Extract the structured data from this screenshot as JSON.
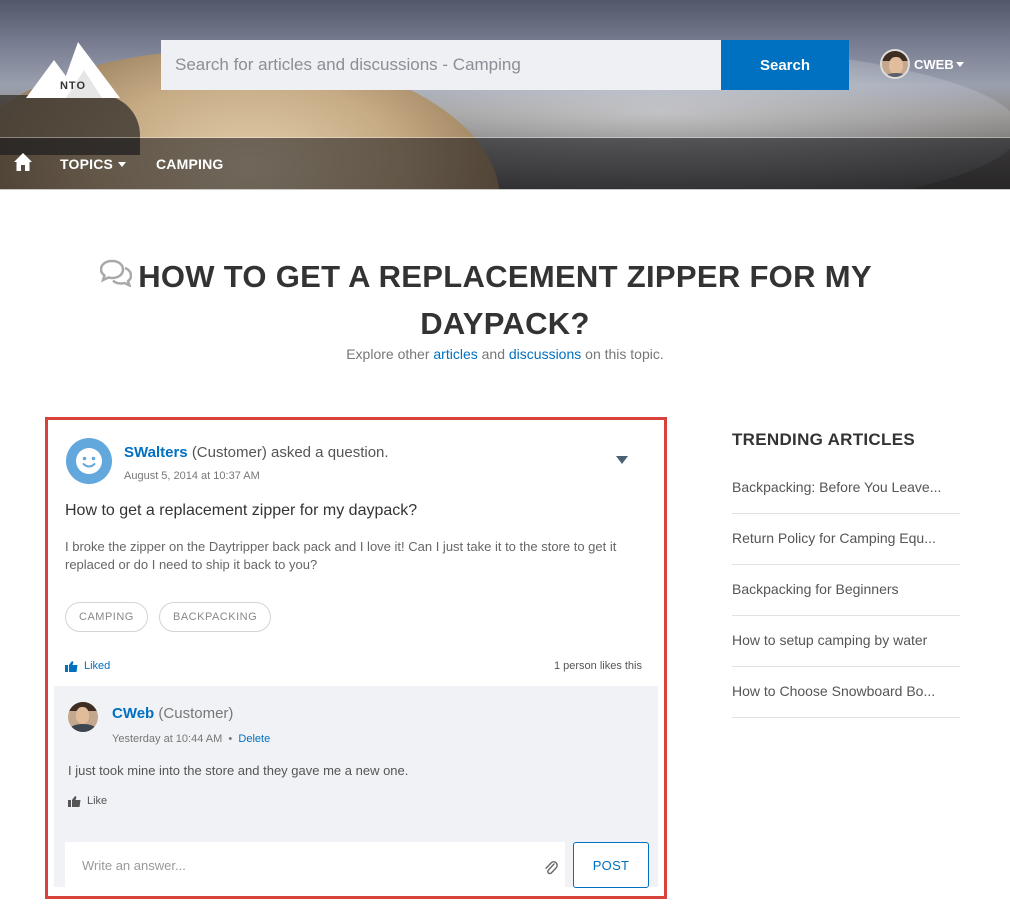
{
  "header": {
    "logo_text": "NTO",
    "search_placeholder": "Search for articles and discussions - Camping",
    "search_button": "Search",
    "user_name": "CWEB"
  },
  "nav": {
    "topics": "TOPICS",
    "camping": "CAMPING"
  },
  "page": {
    "title": "HOW TO GET A REPLACEMENT ZIPPER FOR MY DAYPACK?",
    "subtitle_prefix": "Explore other",
    "subtitle_link1": "articles",
    "subtitle_and": "and",
    "subtitle_link2": "discussions",
    "subtitle_suffix": "on this topic."
  },
  "question": {
    "author": "SWalters",
    "author_role": "(Customer) asked a question.",
    "date": "August 5, 2014 at 10:37 AM",
    "title": "How to get a replacement zipper for my daypack?",
    "body": "I broke the zipper on the Daytripper back pack and I love it! Can I just take it to the store to get it replaced or do I need to ship it back to you?",
    "topics": [
      "CAMPING",
      "BACKPACKING"
    ],
    "liked_label": "Liked",
    "likes_count": "1 person likes this"
  },
  "answer": {
    "author": "CWeb",
    "author_role": "(Customer)",
    "date": "Yesterday at 10:44 AM",
    "separator": "•",
    "delete_label": "Delete",
    "text": "I just took mine into the store and they gave me a new one.",
    "like_label": "Like"
  },
  "composer": {
    "placeholder": "Write an answer...",
    "post_button": "POST"
  },
  "trending": {
    "heading": "TRENDING ARTICLES",
    "items": [
      "Backpacking: Before You Leave...",
      "Return Policy for Camping Equ...",
      "Backpacking for Beginners",
      "How to setup camping by water",
      "How to Choose Snowboard Bo..."
    ]
  },
  "colors": {
    "accent": "#0070c0",
    "highlight_border": "#d9423a"
  }
}
